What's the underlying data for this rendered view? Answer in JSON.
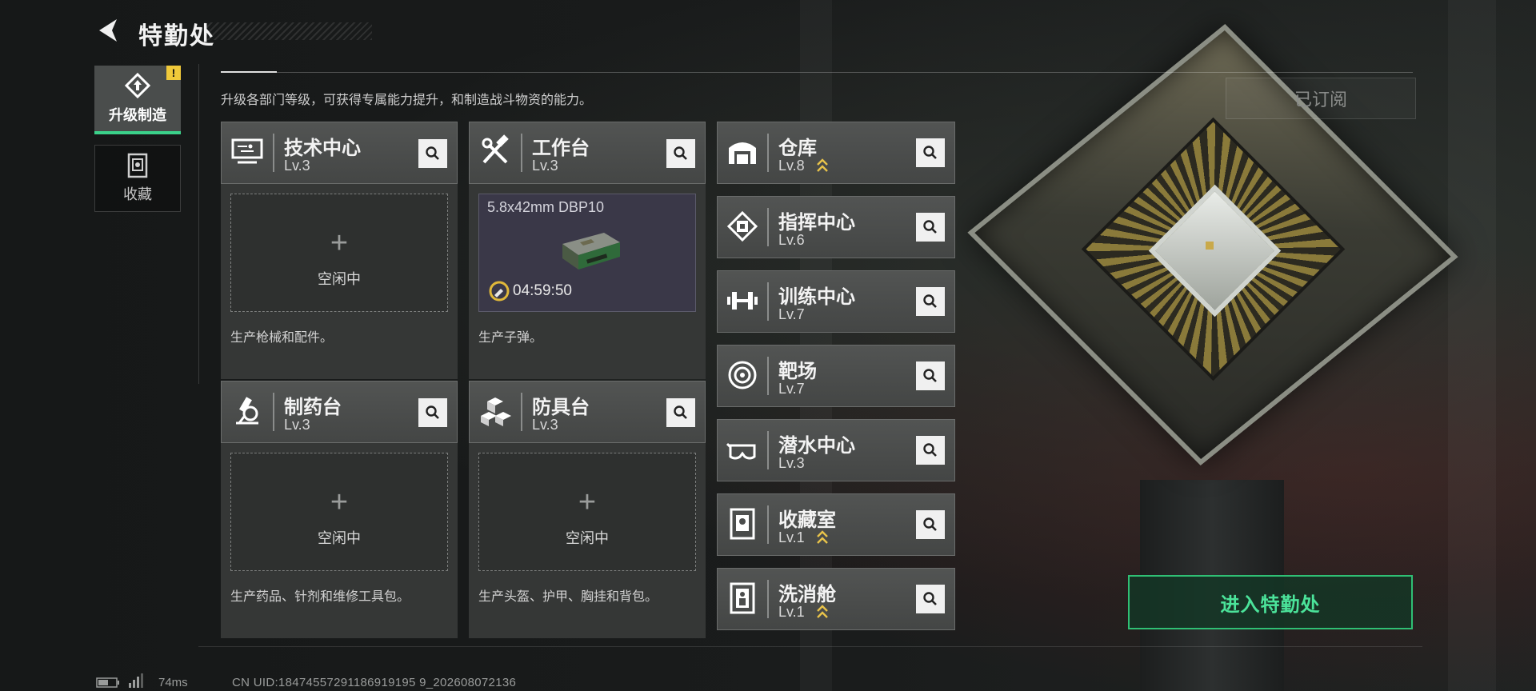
{
  "header": {
    "title": "特勤处",
    "description": "升级各部门等级，可获得专属能力提升，和制造战斗物资的能力。",
    "subscribed_label": "已订阅"
  },
  "nav": {
    "tabs": [
      {
        "label": "升级制造",
        "icon": "upgrade-craft-icon",
        "active": true,
        "badge": "!"
      },
      {
        "label": "收藏",
        "icon": "collection-icon",
        "active": false
      }
    ]
  },
  "facilities_main": [
    {
      "name": "技术中心",
      "level": "Lv.3",
      "icon": "monitor-icon",
      "slot_text": "空闲中",
      "desc": "生产枪械和配件。"
    },
    {
      "name": "工作台",
      "level": "Lv.3",
      "icon": "hammer-wrench-icon",
      "production": {
        "item": "5.8x42mm DBP10",
        "timer": "04:59:50"
      },
      "desc": "生产子弹。"
    },
    {
      "name": "制药台",
      "level": "Lv.3",
      "icon": "microscope-icon",
      "slot_text": "空闲中",
      "desc": "生产药品、针剂和维修工具包。"
    },
    {
      "name": "防具台",
      "level": "Lv.3",
      "icon": "armor-cubes-icon",
      "slot_text": "空闲中",
      "desc": "生产头盔、护甲、胸挂和背包。"
    }
  ],
  "facilities_side": [
    {
      "name": "仓库",
      "level": "Lv.8",
      "icon": "warehouse-icon",
      "upgradable": true
    },
    {
      "name": "指挥中心",
      "level": "Lv.6",
      "icon": "chip-icon",
      "upgradable": false
    },
    {
      "name": "训练中心",
      "level": "Lv.7",
      "icon": "dumbbell-icon",
      "upgradable": false
    },
    {
      "name": "靶场",
      "level": "Lv.7",
      "icon": "target-icon",
      "upgradable": false
    },
    {
      "name": "潜水中心",
      "level": "Lv.3",
      "icon": "goggles-icon",
      "upgradable": false
    },
    {
      "name": "收藏室",
      "level": "Lv.1",
      "icon": "display-case-icon",
      "upgradable": true
    },
    {
      "name": "洗消舱",
      "level": "Lv.1",
      "icon": "decon-icon",
      "upgradable": true
    }
  ],
  "enter_label": "进入特勤处",
  "footer": {
    "latency": "74ms",
    "uid": "CN UID:18474557291186919195 9_202608072136"
  },
  "colors": {
    "accent": "#3bd18a",
    "upgrade": "#e8c34a",
    "badge": "#f0c93a"
  }
}
